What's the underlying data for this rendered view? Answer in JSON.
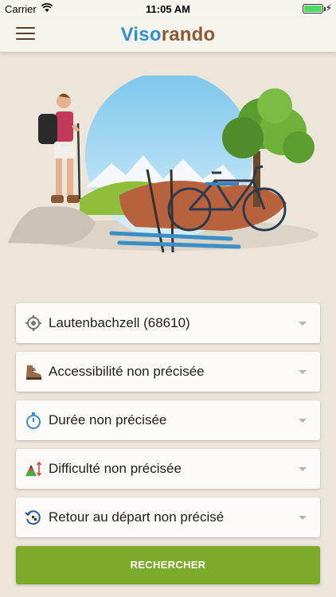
{
  "status_bar": {
    "carrier": "Carrier",
    "time": "11:05 AM"
  },
  "header": {
    "logo_part1": "Viso",
    "logo_part2": "rando",
    "menu_icon": "hamburger-menu-icon"
  },
  "colors": {
    "brand_blue": "#2f8fcf",
    "brand_brown": "#8a5a34",
    "accent_green": "#7cab2a",
    "background": "#ece6da"
  },
  "filters": [
    {
      "icon": "location-target-icon",
      "label": "Lautenbachzell (68610)"
    },
    {
      "icon": "hiking-boot-icon",
      "label": "Accessibilité non précisée"
    },
    {
      "icon": "stopwatch-icon",
      "label": "Durée non précisée"
    },
    {
      "icon": "mountain-difficulty-icon",
      "label": "Difficulté non précisée"
    },
    {
      "icon": "return-start-icon",
      "label": "Retour au départ non précisé"
    }
  ],
  "search_button": {
    "label": "RECHERCHER"
  }
}
